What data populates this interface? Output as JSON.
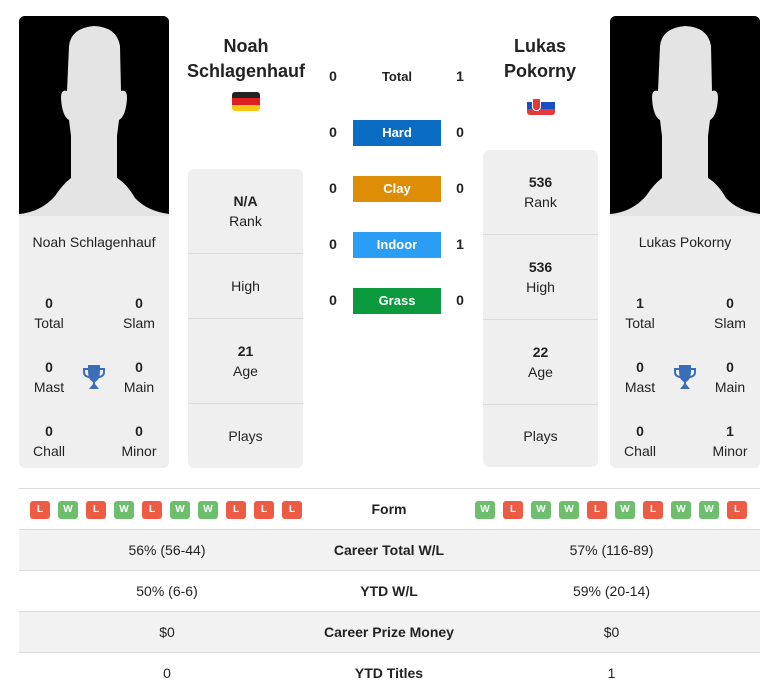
{
  "colors": {
    "hard": "#0a6cc2",
    "clay": "#de8d06",
    "indoor": "#2a9df4",
    "grass": "#0a9a3d",
    "win": "#6dbf6d",
    "loss": "#ee5b44",
    "trophy": "#3a6fb8"
  },
  "player1": {
    "header_first": "Noah",
    "header_last": "Schlagenhauf",
    "country_flag": "germany-flag",
    "card_name": "Noah Schlagenhauf",
    "titles": {
      "total": {
        "value": "0",
        "label": "Total"
      },
      "slam": {
        "value": "0",
        "label": "Slam"
      },
      "mast": {
        "value": "0",
        "label": "Mast"
      },
      "main": {
        "value": "0",
        "label": "Main"
      },
      "chall": {
        "value": "0",
        "label": "Chall"
      },
      "minor": {
        "value": "0",
        "label": "Minor"
      }
    },
    "info": {
      "rank": {
        "value": "N/A",
        "label": "Rank"
      },
      "high": {
        "value": "",
        "label": "High"
      },
      "age": {
        "value": "21",
        "label": "Age"
      },
      "plays": {
        "value": "",
        "label": "Plays"
      }
    },
    "form": [
      "L",
      "W",
      "L",
      "W",
      "L",
      "W",
      "W",
      "L",
      "L",
      "L"
    ],
    "career_wl": "56% (56-44)",
    "ytd_wl": "50% (6-6)",
    "prize_money": "$0",
    "ytd_titles": "0"
  },
  "player2": {
    "header_first": "Lukas",
    "header_last": "Pokorny",
    "country_flag": "slovakia-flag",
    "card_name": "Lukas Pokorny",
    "titles": {
      "total": {
        "value": "1",
        "label": "Total"
      },
      "slam": {
        "value": "0",
        "label": "Slam"
      },
      "mast": {
        "value": "0",
        "label": "Mast"
      },
      "main": {
        "value": "0",
        "label": "Main"
      },
      "chall": {
        "value": "0",
        "label": "Chall"
      },
      "minor": {
        "value": "1",
        "label": "Minor"
      }
    },
    "info": {
      "rank": {
        "value": "536",
        "label": "Rank"
      },
      "high": {
        "value": "536",
        "label": "High"
      },
      "age": {
        "value": "22",
        "label": "Age"
      },
      "plays": {
        "value": "",
        "label": "Plays"
      }
    },
    "form": [
      "W",
      "L",
      "W",
      "W",
      "L",
      "W",
      "L",
      "W",
      "W",
      "L"
    ],
    "career_wl": "57% (116-89)",
    "ytd_wl": "59% (20-14)",
    "prize_money": "$0",
    "ytd_titles": "1"
  },
  "h2h": [
    {
      "label": "Total",
      "p1": "0",
      "p2": "1"
    },
    {
      "label": "Hard",
      "p1": "0",
      "p2": "0"
    },
    {
      "label": "Clay",
      "p1": "0",
      "p2": "0"
    },
    {
      "label": "Indoor",
      "p1": "0",
      "p2": "1"
    },
    {
      "label": "Grass",
      "p1": "0",
      "p2": "0"
    }
  ],
  "table_labels": {
    "form": "Form",
    "career_wl": "Career Total W/L",
    "ytd_wl": "YTD W/L",
    "prize_money": "Career Prize Money",
    "ytd_titles": "YTD Titles"
  }
}
